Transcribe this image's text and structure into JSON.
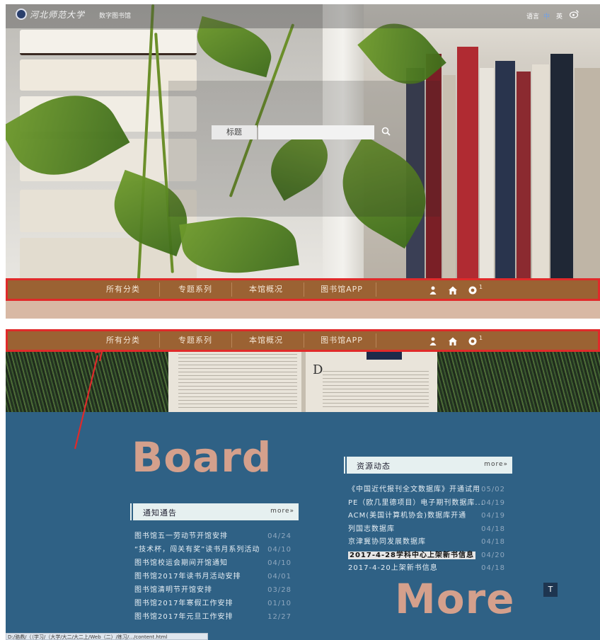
{
  "header": {
    "logo_text": "河北师范大学",
    "logo_sub": "数字图书馆",
    "lang_label": "语言",
    "lang_zh": "中",
    "lang_en": "英"
  },
  "search": {
    "field_label": "标题",
    "input_value": "",
    "placeholder": ""
  },
  "nav": {
    "items": [
      "所有分类",
      "专题系列",
      "本馆概况",
      "图书馆APP"
    ],
    "badge_count": "1"
  },
  "board": {
    "heading": "Board",
    "more_heading": "More"
  },
  "notices": {
    "title": "通知通告",
    "more": "more»",
    "items": [
      {
        "title": "图书馆五一劳动节开馆安排",
        "date": "04/24"
      },
      {
        "title": "“技术杯，闯关有奖”读书月系列活动",
        "date": "04/10"
      },
      {
        "title": "图书馆校运会期间开馆通知",
        "date": "04/10"
      },
      {
        "title": "图书馆2017年读书月活动安排",
        "date": "04/01"
      },
      {
        "title": "图书馆清明节开馆安排",
        "date": "03/28"
      },
      {
        "title": "图书馆2017年寒假工作安排",
        "date": "01/10"
      },
      {
        "title": "图书馆2017年元旦工作安排",
        "date": "12/27"
      }
    ]
  },
  "resources": {
    "title": "资源动态",
    "more": "more»",
    "items": [
      {
        "title": "《中国近代报刊全文数据库》开通试用",
        "date": "05/02"
      },
      {
        "title": "PE（欧几里德项目）电子期刊数据库...",
        "date": "04/19"
      },
      {
        "title": "ACM(美国计算机协会)数据库开通",
        "date": "04/19"
      },
      {
        "title": "列国志数据库",
        "date": "04/18"
      },
      {
        "title": "京津冀协同发展数据库",
        "date": "04/18"
      },
      {
        "title": "2017-4-28学科中心上架新书信息",
        "date": "04/20"
      },
      {
        "title": "2017-4-20上架新书信息",
        "date": "04/18"
      }
    ]
  },
  "to_top_label": "T",
  "status_bar": "D:/骆鼎/（（学习/（大学/大二/大二上/Web（二）/练习/.../content.html",
  "colors": {
    "nav_brown": "#9b6233",
    "highlight_red": "#e02a2a",
    "main_blue": "#2f6185",
    "accent_salmon": "#d4a08c"
  }
}
